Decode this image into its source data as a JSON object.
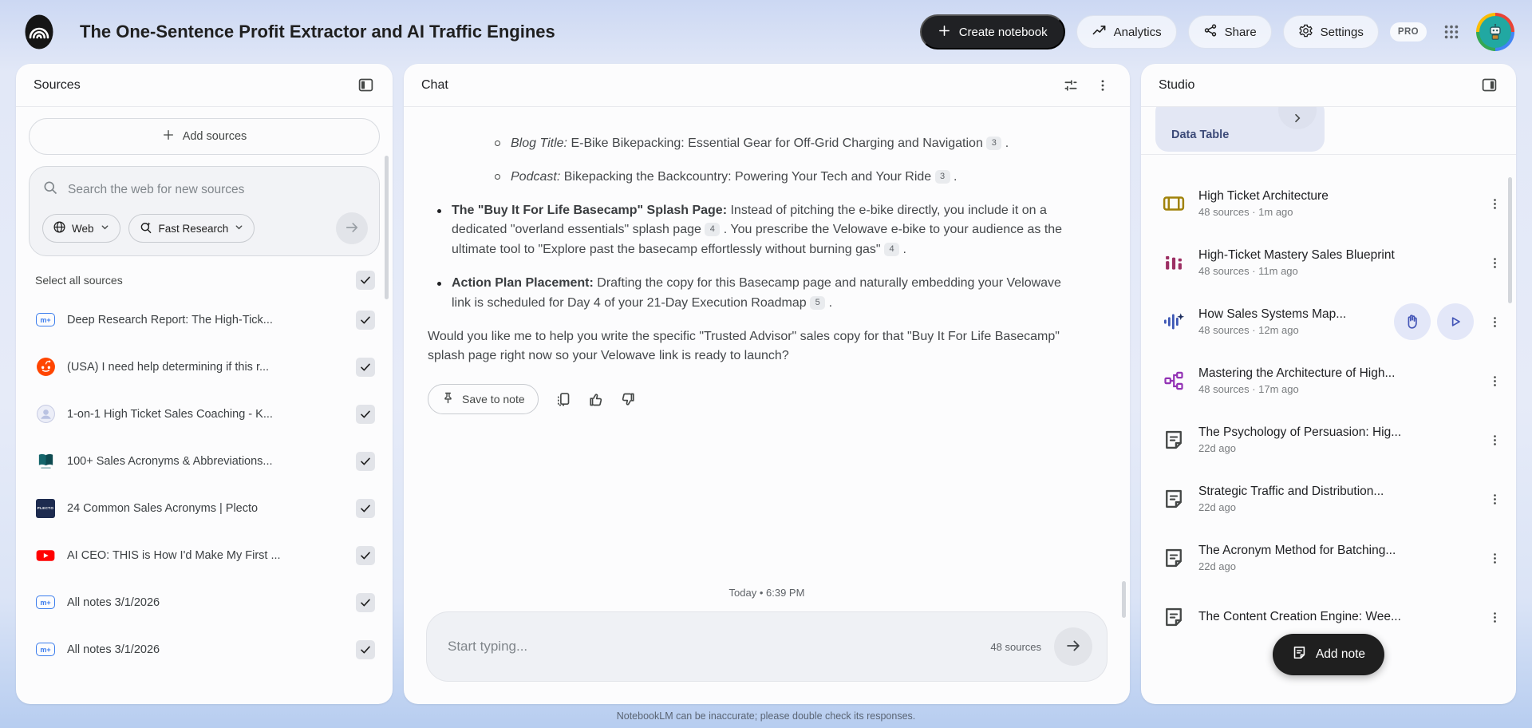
{
  "header": {
    "logo": "notebooklm-logo",
    "title": "The One-Sentence Profit Extractor and AI Traffic Engines",
    "create_notebook": {
      "label": "Create notebook",
      "icon": "plus-icon"
    },
    "analytics": {
      "label": "Analytics",
      "icon": "trending-up-icon"
    },
    "share": {
      "label": "Share",
      "icon": "share-icon"
    },
    "settings": {
      "label": "Settings",
      "icon": "gear-icon"
    },
    "pro_badge": "PRO",
    "apps_icon": "apps-grid-icon",
    "avatar_icon": "robot-avatar"
  },
  "colors": {
    "primary_button_bg": "#202124",
    "citation_chip_bg": "#e9ebee",
    "tool_chip_bg": "#e3e7f4",
    "tool_chip_text": "#3c4a78",
    "audio_button_bg": "#e3e7f8",
    "audio_button_icon": "#4456b7"
  },
  "sources_panel": {
    "title": "Sources",
    "collapse_icon": "collapse-panel-left-icon",
    "add_sources_label": "Add sources",
    "search_placeholder": "Search the web for new sources",
    "web_dropdown": {
      "label": "Web",
      "icon": "globe-icon"
    },
    "research_dropdown": {
      "label": "Fast Research",
      "icon": "search-sparkle-icon"
    },
    "submit_icon": "arrow-right-icon",
    "select_all_label": "Select all sources",
    "items": [
      {
        "icon": "note-source-icon",
        "label": "Deep Research Report: The High-Tick...",
        "checked": true
      },
      {
        "icon": "reddit-icon",
        "label": "(USA) I need help determining if this r...",
        "checked": true
      },
      {
        "icon": "web-favicon-icon",
        "label": "1-on-1 High Ticket Sales Coaching - K...",
        "checked": true
      },
      {
        "icon": "book-favicon-icon",
        "label": "100+ Sales Acronyms & Abbreviations...",
        "checked": true
      },
      {
        "icon": "plecto-favicon-icon",
        "label": "24 Common Sales Acronyms | Plecto",
        "checked": true
      },
      {
        "icon": "youtube-icon",
        "label": "AI CEO: THIS is How I'd Make My First ...",
        "checked": true
      },
      {
        "icon": "note-source-icon",
        "label": "All notes 3/1/2026",
        "checked": true
      },
      {
        "icon": "note-source-icon",
        "label": "All notes 3/1/2026",
        "checked": true
      }
    ]
  },
  "chat_panel": {
    "title": "Chat",
    "tune_icon": "tune-icon",
    "more_icon": "kebab-menu-icon",
    "messages": [
      {
        "type": "subbullet",
        "segments": [
          {
            "style": "italic",
            "text": "Blog Title:"
          },
          {
            "style": "normal",
            "text": " E-Bike Bikepacking: Essential Gear for Off-Grid Charging and Navigation "
          },
          {
            "style": "citation",
            "text": "3"
          },
          {
            "style": "normal",
            "text": " ."
          }
        ]
      },
      {
        "type": "subbullet",
        "segments": [
          {
            "style": "italic",
            "text": "Podcast:"
          },
          {
            "style": "normal",
            "text": " Bikepacking the Backcountry: Powering Your Tech and Your Ride "
          },
          {
            "style": "citation",
            "text": "3"
          },
          {
            "style": "normal",
            "text": " ."
          }
        ]
      },
      {
        "type": "bullet",
        "segments": [
          {
            "style": "bold",
            "text": "The \"Buy It For Life Basecamp\" Splash Page:"
          },
          {
            "style": "normal",
            "text": " Instead of pitching the e-bike directly, you include it on a dedicated \"overland essentials\" splash page "
          },
          {
            "style": "citation",
            "text": "4"
          },
          {
            "style": "normal",
            "text": " . You prescribe the Velowave e-bike to your audience as the ultimate tool to \"Explore past the basecamp effortlessly without burning gas\" "
          },
          {
            "style": "citation",
            "text": "4"
          },
          {
            "style": "normal",
            "text": " ."
          }
        ]
      },
      {
        "type": "bullet",
        "segments": [
          {
            "style": "bold",
            "text": "Action Plan Placement:"
          },
          {
            "style": "normal",
            "text": " Drafting the copy for this Basecamp page and naturally embedding your Velowave link is scheduled for Day 4 of your 21-Day Execution Roadmap "
          },
          {
            "style": "citation",
            "text": "5"
          },
          {
            "style": "normal",
            "text": " ."
          }
        ]
      },
      {
        "type": "paragraph",
        "segments": [
          {
            "style": "normal",
            "text": "Would you like me to help you write the specific \"Trusted Advisor\" sales copy for that \"Buy It For Life Basecamp\" splash page right now so your Velowave link is ready to launch?"
          }
        ]
      }
    ],
    "save_to_note": {
      "label": "Save to note",
      "icon": "pin-icon"
    },
    "message_actions": [
      {
        "icon": "copy-icon"
      },
      {
        "icon": "thumb-up-icon"
      },
      {
        "icon": "thumb-down-icon"
      }
    ],
    "day_label": "Today • 6:39 PM",
    "input_placeholder": "Start typing...",
    "source_count": "48 sources",
    "send_icon": "arrow-right-icon",
    "disclaimer": "NotebookLM can be inaccurate; please double check its responses."
  },
  "studio_panel": {
    "title": "Studio",
    "collapse_icon": "collapse-panel-right-icon",
    "tool_chip": {
      "label": "Data Table",
      "icon": "chevron-right-icon"
    },
    "items": [
      {
        "icon": "flashcards-icon",
        "icon_color": "#a0820a",
        "title": "High Ticket Architecture",
        "meta": "48 sources · 1m ago",
        "audio": false
      },
      {
        "icon": "bar-report-icon",
        "icon_color": "#9c2f63",
        "title": "High-Ticket Mastery Sales Blueprint",
        "meta": "48 sources · 11m ago",
        "audio": false
      },
      {
        "icon": "audio-waveform-icon",
        "icon_color": "#3c56b4",
        "title": "How Sales Systems Map...",
        "meta": "48 sources · 12m ago",
        "audio": true
      },
      {
        "icon": "mindmap-icon",
        "icon_color": "#9333b5",
        "title": "Mastering the Architecture of High...",
        "meta": "48 sources · 17m ago",
        "audio": false
      },
      {
        "icon": "note-doc-icon",
        "icon_color": "#444746",
        "title": "The Psychology of Persuasion: Hig...",
        "meta": "22d ago",
        "audio": false
      },
      {
        "icon": "note-doc-icon",
        "icon_color": "#444746",
        "title": "Strategic Traffic and Distribution...",
        "meta": "22d ago",
        "audio": false
      },
      {
        "icon": "note-doc-icon",
        "icon_color": "#444746",
        "title": "The Acronym Method for Batching...",
        "meta": "22d ago",
        "audio": false
      },
      {
        "icon": "note-doc-icon",
        "icon_color": "#444746",
        "title": "The Content Creation Engine: Wee...",
        "meta": "",
        "audio": false
      }
    ],
    "audio_overview_actions": [
      {
        "icon": "interactive-hand-icon"
      },
      {
        "icon": "play-icon"
      }
    ],
    "add_note": {
      "label": "Add note",
      "icon": "note-add-icon"
    }
  }
}
